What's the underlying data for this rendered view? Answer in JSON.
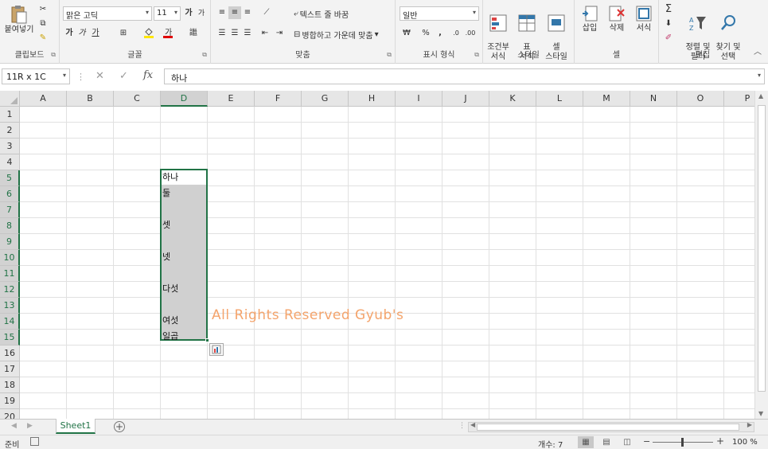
{
  "ribbon": {
    "clipboard": {
      "label": "클립보드",
      "paste": "붙여넣기"
    },
    "font": {
      "label": "글꼴",
      "name": "맑은 고딕",
      "size": "11",
      "grow": "가",
      "shrink": "가",
      "bold": "가",
      "italic": "가",
      "underline": "가",
      "highlight_color": "#ffe600",
      "font_color": "#e00000"
    },
    "alignment": {
      "label": "맞춤",
      "wrap": "텍스트 줄 바꿈",
      "merge": "병합하고 가운데 맞춤"
    },
    "number": {
      "label": "표시 형식",
      "format": "일반",
      "percent": "%",
      "comma": ","
    },
    "styles": {
      "label": "스타일",
      "conditional": "조건부\n서식",
      "table": "표\n서식",
      "cell_style": "셀\n스타일"
    },
    "cells": {
      "label": "셀",
      "insert": "삽입",
      "delete": "삭제",
      "format": "서식"
    },
    "editing": {
      "label": "편집",
      "sum": "Σ",
      "sort": "정렬 및\n필터",
      "find": "찾기 및\n선택"
    }
  },
  "formula_bar": {
    "name_box": "11R x 1C",
    "content": "하나"
  },
  "grid": {
    "columns": [
      "A",
      "B",
      "C",
      "D",
      "E",
      "F",
      "G",
      "H",
      "I",
      "J",
      "K",
      "L",
      "M",
      "N",
      "O",
      "P"
    ],
    "selected_column": "D",
    "rows": [
      1,
      2,
      3,
      4,
      5,
      6,
      7,
      8,
      9,
      10,
      11,
      12,
      13,
      14,
      15,
      16,
      17,
      18,
      19,
      20
    ],
    "selected_rows": [
      5,
      6,
      7,
      8,
      9,
      10,
      11,
      12,
      13,
      14,
      15
    ],
    "cells": [
      {
        "row": 5,
        "value": "하나"
      },
      {
        "row": 6,
        "value": "둘"
      },
      {
        "row": 8,
        "value": "셋"
      },
      {
        "row": 10,
        "value": "넷"
      },
      {
        "row": 12,
        "value": "다섯"
      },
      {
        "row": 14,
        "value": "여섯"
      },
      {
        "row": 15,
        "value": "일곱"
      }
    ],
    "accent_color": "#217346",
    "watermark": "All Rights Reserved Gyub's"
  },
  "sheets": {
    "tabs": [
      "Sheet1"
    ],
    "active": "Sheet1"
  },
  "status": {
    "ready": "준비",
    "count": "개수: 7",
    "zoom": "100 %"
  }
}
